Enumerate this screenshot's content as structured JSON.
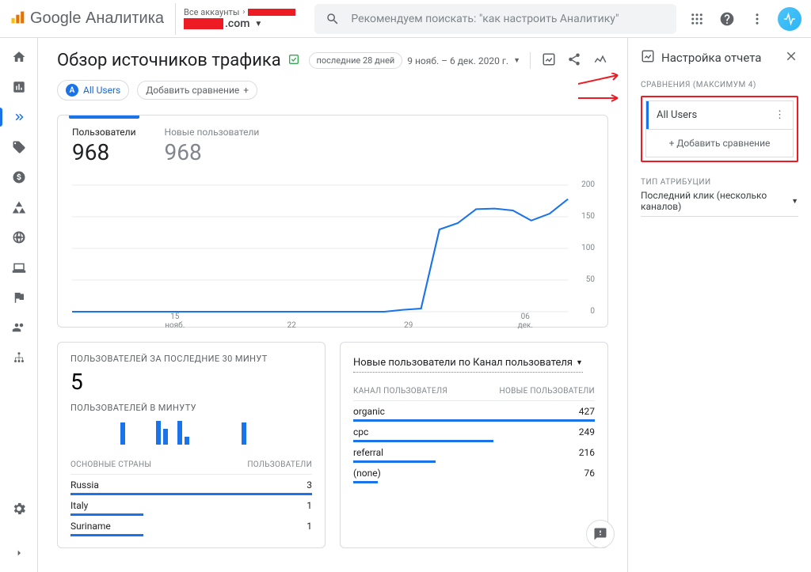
{
  "header": {
    "logo_text": "Google Аналитика",
    "all_accounts": "Все аккаунты",
    "domain_suffix": ".com",
    "search_placeholder": "Рекомендуем поискать: \"как настроить Аналитику\""
  },
  "page": {
    "title": "Обзор источников трафика",
    "date_range_chip": "последние 28 дней",
    "date_range_text": "9 нояб. – 6 дек. 2020 г.",
    "all_users_badge": "A",
    "all_users_label": "All Users",
    "add_compare": "Добавить сравнение"
  },
  "metrics": {
    "users_label": "Пользователи",
    "users_value": "968",
    "new_users_label": "Новые пользователи",
    "new_users_value": "968"
  },
  "chart_data": {
    "type": "line",
    "xlabel": "",
    "ylabel": "",
    "ylim": [
      0,
      200
    ],
    "yticks": [
      0,
      50,
      100,
      150,
      200
    ],
    "x": [
      "15",
      "22",
      "29",
      "06"
    ],
    "x_sublabels": [
      "нояб.",
      "",
      "",
      "дек."
    ],
    "series": [
      {
        "name": "Пользователи",
        "values": [
          0,
          0,
          0,
          0,
          0,
          0,
          0,
          0,
          0,
          0,
          0,
          0,
          0,
          0,
          0,
          0,
          0,
          0,
          3,
          5,
          130,
          140,
          162,
          163,
          160,
          144,
          155,
          178
        ]
      }
    ]
  },
  "realtime": {
    "title": "ПОЛЬЗОВАТЕЛЕЙ ЗА ПОСЛЕДНИЕ 30 МИНУТ",
    "value": "5",
    "per_minute_label": "ПОЛЬЗОВАТЕЛЕЙ В МИНУТУ",
    "minute_bars": [
      0,
      0,
      0,
      0,
      0,
      0,
      0,
      28,
      0,
      0,
      0,
      0,
      30,
      20,
      0,
      30,
      10,
      0,
      0,
      0,
      0,
      0,
      0,
      0,
      28,
      0,
      0,
      0,
      0,
      0
    ],
    "countries_header_left": "ОСНОВНЫЕ СТРАНЫ",
    "countries_header_right": "ПОЛЬЗОВАТЕЛИ",
    "countries": [
      {
        "name": "Russia",
        "value": "3",
        "barClass": "r100"
      },
      {
        "name": "Italy",
        "value": "1",
        "barClass": "r30"
      },
      {
        "name": "Suriname",
        "value": "1",
        "barClass": "r30"
      }
    ]
  },
  "channels": {
    "picker": "Новые пользователи по Канал пользователя",
    "col_left": "КАНАЛ ПОЛЬЗОВАТЕЛЯ",
    "col_right": "НОВЫЕ ПОЛЬЗОВАТЕЛИ",
    "rows": [
      {
        "name": "organic",
        "value": "427",
        "barClass": "r100"
      },
      {
        "name": "cpc",
        "value": "249",
        "barClass": "r58"
      },
      {
        "name": "referral",
        "value": "216",
        "barClass": "r34"
      },
      {
        "name": "(none)",
        "value": "76",
        "barClass": "r10"
      }
    ]
  },
  "side": {
    "title": "Настройка отчета",
    "comparisons_label": "СРАВНЕНИЯ (МАКСИМУМ 4)",
    "all_users": "All Users",
    "add_compare": "Добавить сравнение",
    "attr_label": "ТИП АТРИБУЦИИ",
    "attr_value": "Последний клик (несколько каналов)"
  }
}
